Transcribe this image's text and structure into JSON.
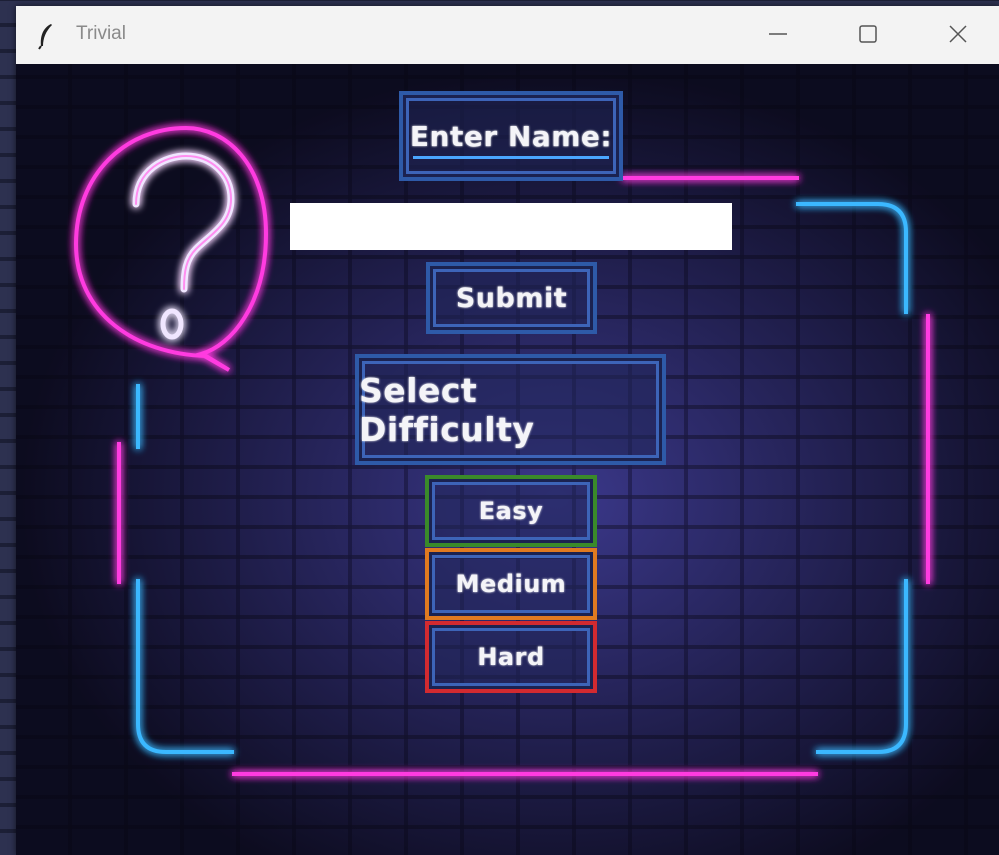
{
  "window": {
    "title": "Trivial",
    "app_icon": "feather-icon",
    "controls": [
      "minimize-icon",
      "maximize-icon",
      "close-icon"
    ]
  },
  "form": {
    "name_label": "Enter Name:",
    "name_value": "",
    "submit_label": "Submit",
    "difficulty_label": "Select Difficulty",
    "difficulties": {
      "easy": "Easy",
      "medium": "Medium",
      "hard": "Hard"
    }
  },
  "colors": {
    "neon_pink": "#ff3ae0",
    "neon_blue": "#3ab8ff",
    "easy_border": "#3a8a2a",
    "medium_border": "#e07a20",
    "hard_border": "#d22a30",
    "frame_blue": "#2e5aa8"
  },
  "decor": {
    "question_mark_icon": "question-bubble-icon"
  }
}
